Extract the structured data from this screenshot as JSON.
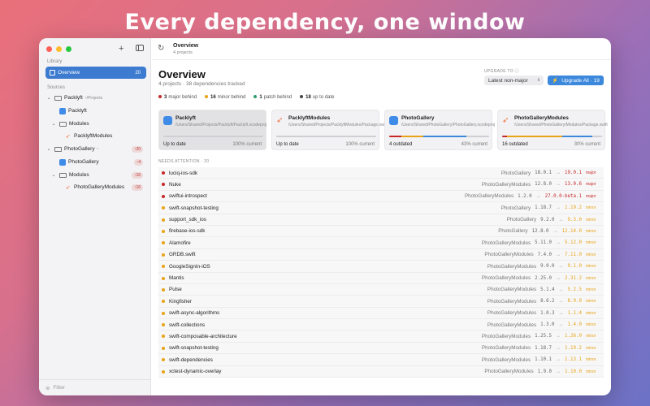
{
  "headline": "Every dependency, one window",
  "colors": {
    "major": "#c62828",
    "minor": "#e8a317",
    "patch": "#2e9e6b",
    "up_to_date": "#444444",
    "accent": "#3b88dc"
  },
  "sidebar": {
    "library_label": "Library",
    "overview": {
      "label": "Overview",
      "count": "20"
    },
    "sources_label": "Sources",
    "items": [
      {
        "label": "Packlyft",
        "path": "~/Projects",
        "badge": ""
      },
      {
        "label": "Packlyft",
        "badge": ""
      },
      {
        "label": "Modules",
        "badge": ""
      },
      {
        "label": "PacklyftModules",
        "badge": ""
      },
      {
        "label": "PhotoGallery",
        "badge": "↑20"
      },
      {
        "label": "PhotoGallery",
        "badge": "↑4"
      },
      {
        "label": "Modules",
        "badge": "↑16"
      },
      {
        "label": "PhotoGalleryModules",
        "badge": "↑16"
      }
    ],
    "filter_placeholder": "Filter"
  },
  "toolbar": {
    "title": "Overview",
    "subtitle": "4 projects"
  },
  "overview": {
    "title": "Overview",
    "subtitle": "4 projects · 38 dependencies tracked",
    "upgrade_to_label": "UPGRADE TO",
    "upgrade_select": "Latest non-major",
    "upgrade_all": "Upgrade All · 19",
    "legend": [
      {
        "count": "3",
        "label": "major behind",
        "color": "#c62828"
      },
      {
        "count": "16",
        "label": "minor behind",
        "color": "#e8a317"
      },
      {
        "count": "1",
        "label": "patch behind",
        "color": "#2e9e6b"
      },
      {
        "count": "18",
        "label": "up to date",
        "color": "#444444"
      }
    ]
  },
  "cards": [
    {
      "name": "Packlyft",
      "path": "/Users/Shared/Projects/Packlyft/Packlyft.xcodeproj",
      "status": "Up to date",
      "percent": "100% current",
      "icon": "xcode-app-icon",
      "current": 1.0,
      "minor": 0,
      "major": 0
    },
    {
      "name": "PacklyftModules",
      "path": "/Users/Shared/Projects/PacklyftModules/Package.swift",
      "status": "Up to date",
      "percent": "100% current",
      "icon": "swift-icon",
      "current": 1.0,
      "minor": 0,
      "major": 0
    },
    {
      "name": "PhotoGallery",
      "path": "/Users/Shared/PhotoGallery/PhotoGallery.xcodeproj",
      "status": "4 outdated",
      "percent": "43% current",
      "icon": "xcode-app-icon",
      "current": 0.43,
      "minor": 0.22,
      "major": 0.12
    },
    {
      "name": "PhotoGalleryModules",
      "path": "/Users/Shared/PhotoGallery/Modules/Package.swift",
      "status": "16 outdated",
      "percent": "30% current",
      "icon": "swift-icon",
      "current": 0.3,
      "minor": 0.55,
      "major": 0.05
    }
  ],
  "needs_attention_label": "NEEDS ATTENTION · 20",
  "deps": [
    {
      "name": "luciq-ios-sdk",
      "project": "PhotoGallery",
      "current": "18.0.1",
      "latest": "19.0.1",
      "kind": "major"
    },
    {
      "name": "Nuke",
      "project": "PhotoGalleryModules",
      "current": "12.8.0",
      "latest": "13.0.6",
      "kind": "major"
    },
    {
      "name": "swiftui-introspect",
      "project": "PhotoGalleryModules",
      "current": "1.2.0",
      "latest": "27.0.0-beta.1",
      "kind": "major"
    },
    {
      "name": "swift-snapshot-testing",
      "project": "PhotoGallery",
      "current": "1.18.7",
      "latest": "1.19.2",
      "kind": "minor"
    },
    {
      "name": "support_sdk_ios",
      "project": "PhotoGallery",
      "current": "9.2.0",
      "latest": "9.3.0",
      "kind": "minor"
    },
    {
      "name": "firebase-ios-sdk",
      "project": "PhotoGallery",
      "current": "12.8.0",
      "latest": "12.14.0",
      "kind": "minor"
    },
    {
      "name": "Alamofire",
      "project": "PhotoGalleryModules",
      "current": "5.11.0",
      "latest": "5.12.0",
      "kind": "minor"
    },
    {
      "name": "GRDB.swift",
      "project": "PhotoGalleryModules",
      "current": "7.4.0",
      "latest": "7.11.0",
      "kind": "minor"
    },
    {
      "name": "GoogleSignIn-iOS",
      "project": "PhotoGalleryModules",
      "current": "9.0.0",
      "latest": "9.1.0",
      "kind": "minor"
    },
    {
      "name": "Mantis",
      "project": "PhotoGalleryModules",
      "current": "2.25.0",
      "latest": "2.31.2",
      "kind": "minor"
    },
    {
      "name": "Pulse",
      "project": "PhotoGalleryModules",
      "current": "5.1.4",
      "latest": "5.2.5",
      "kind": "minor"
    },
    {
      "name": "Kingfisher",
      "project": "PhotoGalleryModules",
      "current": "8.6.2",
      "latest": "8.9.0",
      "kind": "minor"
    },
    {
      "name": "swift-async-algorithms",
      "project": "PhotoGalleryModules",
      "current": "1.0.3",
      "latest": "1.1.4",
      "kind": "minor"
    },
    {
      "name": "swift-collections",
      "project": "PhotoGalleryModules",
      "current": "1.3.0",
      "latest": "1.4.0",
      "kind": "minor"
    },
    {
      "name": "swift-composable-architecture",
      "project": "PhotoGalleryModules",
      "current": "1.25.5",
      "latest": "1.26.0",
      "kind": "minor"
    },
    {
      "name": "swift-snapshot-testing",
      "project": "PhotoGalleryModules",
      "current": "1.18.7",
      "latest": "1.19.2",
      "kind": "minor"
    },
    {
      "name": "swift-dependencies",
      "project": "PhotoGalleryModules",
      "current": "1.10.1",
      "latest": "1.13.1",
      "kind": "minor"
    },
    {
      "name": "xctest-dynamic-overlay",
      "project": "PhotoGalleryModules",
      "current": "1.9.0",
      "latest": "1.10.0",
      "kind": "minor"
    }
  ]
}
